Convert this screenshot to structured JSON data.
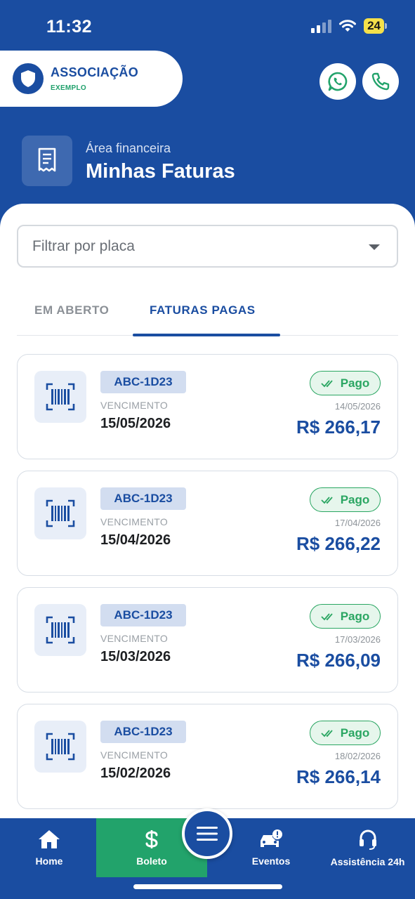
{
  "status_bar": {
    "time": "11:32",
    "battery": "24"
  },
  "header": {
    "brand_name": "ASSOCIAÇÃO",
    "brand_sub": "EXEMPLO",
    "section_subtitle": "Área financeira",
    "section_title": "Minhas Faturas"
  },
  "filter": {
    "placeholder": "Filtrar por placa"
  },
  "tabs": [
    {
      "label": "EM ABERTO",
      "active": false
    },
    {
      "label": "FATURAS PAGAS",
      "active": true
    }
  ],
  "invoices": [
    {
      "plate": "ABC-1D23",
      "due_label": "VENCIMENTO",
      "due_date": "15/05/2026",
      "status": "Pago",
      "paid_date": "14/05/2026",
      "amount": "R$ 266,17"
    },
    {
      "plate": "ABC-1D23",
      "due_label": "VENCIMENTO",
      "due_date": "15/04/2026",
      "status": "Pago",
      "paid_date": "17/04/2026",
      "amount": "R$ 266,22"
    },
    {
      "plate": "ABC-1D23",
      "due_label": "VENCIMENTO",
      "due_date": "15/03/2026",
      "status": "Pago",
      "paid_date": "17/03/2026",
      "amount": "R$ 266,09"
    },
    {
      "plate": "ABC-1D23",
      "due_label": "VENCIMENTO",
      "due_date": "15/02/2026",
      "status": "Pago",
      "paid_date": "18/02/2026",
      "amount": "R$ 266,14"
    }
  ],
  "bottom_nav": {
    "home": "Home",
    "boleto": "Boleto",
    "eventos": "Eventos",
    "assistencia": "Assistência 24h"
  },
  "colors": {
    "primary": "#1a4da1",
    "accent_green": "#22a36b",
    "paid_green": "#2aa662"
  },
  "icons": [
    "shield-icon",
    "whatsapp-icon",
    "phone-icon",
    "invoice-icon",
    "barcode-icon",
    "check-icon",
    "home-icon",
    "dollar-icon",
    "menu-icon",
    "car-alert-icon",
    "headset-icon"
  ]
}
